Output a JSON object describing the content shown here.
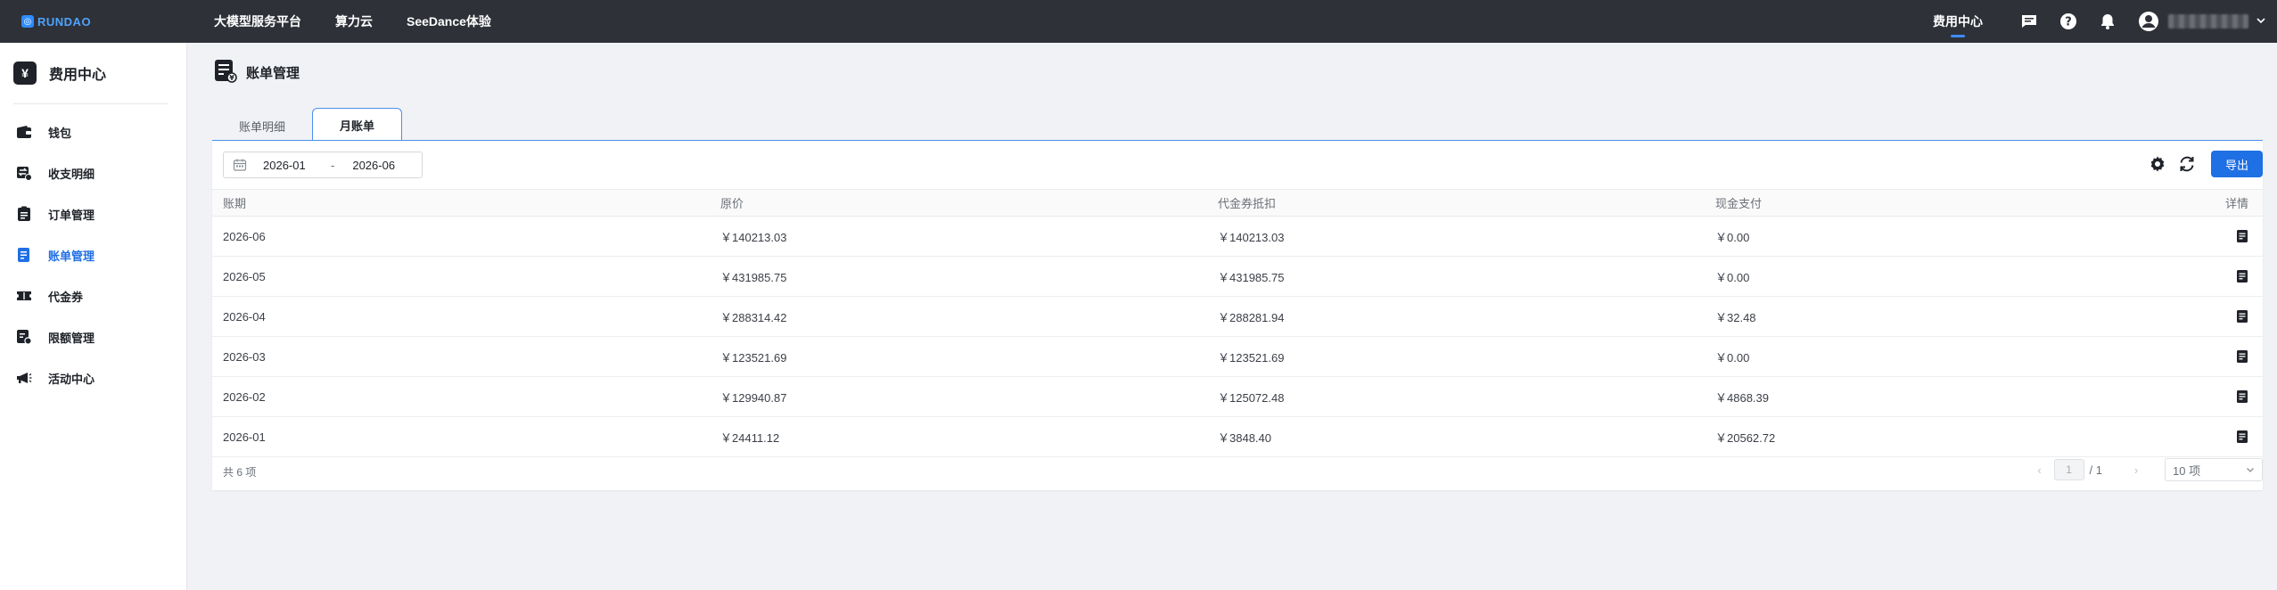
{
  "topbar": {
    "logo_text": "RUNDAO",
    "nav": [
      "大模型服务平台",
      "算力云",
      "SeeDance体验"
    ],
    "fee_center": "费用中心"
  },
  "sidebar": {
    "title": "费用中心",
    "title_icon": "¥",
    "items": [
      {
        "label": "钱包",
        "icon": "wallet-icon"
      },
      {
        "label": "收支明细",
        "icon": "transfer-icon"
      },
      {
        "label": "订单管理",
        "icon": "clipboard-icon"
      },
      {
        "label": "账单管理",
        "icon": "bill-icon",
        "active": true
      },
      {
        "label": "代金券",
        "icon": "ticket-icon"
      },
      {
        "label": "限额管理",
        "icon": "limit-icon"
      },
      {
        "label": "活动中心",
        "icon": "megaphone-icon"
      }
    ]
  },
  "page": {
    "title": "账单管理",
    "tabs": [
      "账单明细",
      "月账单"
    ],
    "active_tab": 1
  },
  "filter": {
    "start": "2026-01",
    "sep": "-",
    "end": "2026-06",
    "export_label": "导出"
  },
  "table": {
    "headers": [
      "账期",
      "原价",
      "代金券抵扣",
      "现金支付",
      "详情"
    ],
    "rows": [
      [
        "2026-06",
        "￥140213.03",
        "￥140213.03",
        "￥0.00"
      ],
      [
        "2026-05",
        "￥431985.75",
        "￥431985.75",
        "￥0.00"
      ],
      [
        "2026-04",
        "￥288314.42",
        "￥288281.94",
        "￥32.48"
      ],
      [
        "2026-03",
        "￥123521.69",
        "￥123521.69",
        "￥0.00"
      ],
      [
        "2026-02",
        "￥129940.87",
        "￥125072.48",
        "￥4868.39"
      ],
      [
        "2026-01",
        "￥24411.12",
        "￥3848.40",
        "￥20562.72"
      ]
    ]
  },
  "footer": {
    "total": "共 6 项",
    "page_current": "1",
    "page_total": "/ 1",
    "page_size": "10 项"
  },
  "colors": {
    "accent": "#1f6fe5",
    "topbar": "#2e3138"
  }
}
